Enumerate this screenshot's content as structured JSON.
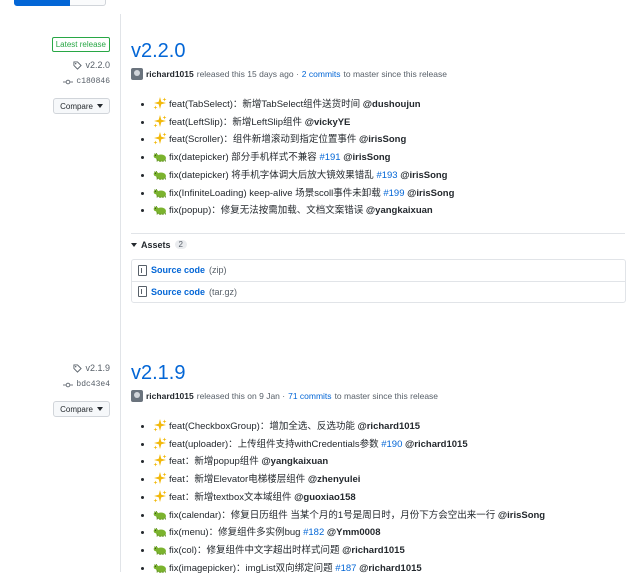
{
  "releases": [
    {
      "latest_label": "Latest release",
      "tag": "v2.2.0",
      "commit": "c180846",
      "compare_label": "Compare",
      "title": "v2.2.0",
      "author": "richard1015",
      "released_text": "released this 15 days ago ·",
      "commits_link": "2 commits",
      "since_text": "to master since this release",
      "notes": [
        {
          "emoji": "sparkles",
          "text": "feat(TabSelect)：新增TabSelect组件送货时间 ",
          "issue": "",
          "mention": "@dushoujun"
        },
        {
          "emoji": "sparkles",
          "text": "feat(LeftSlip)：新增LeftSlip组件 ",
          "issue": "",
          "mention": "@vickyYE"
        },
        {
          "emoji": "sparkles",
          "text": "feat(Scroller)：组件新增滚动到指定位置事件 ",
          "issue": "",
          "mention": "@irisSong"
        },
        {
          "emoji": "bug",
          "text": "fix(datepicker) 部分手机样式不兼容 ",
          "issue": "#191",
          "mention": "@irisSong"
        },
        {
          "emoji": "bug",
          "text": "fix(datepicker) 将手机字体调大后放大镜效果错乱 ",
          "issue": "#193",
          "mention": "@irisSong"
        },
        {
          "emoji": "bug",
          "text": "fix(InfiniteLoading) keep-alive 场景scoll事件未卸载 ",
          "issue": "#199",
          "mention": "@irisSong"
        },
        {
          "emoji": "bug",
          "text": "fix(popup)：修复无法按需加载、文档文案错误 ",
          "issue": "",
          "mention": "@yangkaixuan"
        }
      ],
      "assets_label": "Assets",
      "assets_count": "2",
      "assets": [
        {
          "name": "Source code",
          "ext": "(zip)"
        },
        {
          "name": "Source code",
          "ext": "(tar.gz)"
        }
      ]
    },
    {
      "tag": "v2.1.9",
      "commit": "bdc43e4",
      "compare_label": "Compare",
      "title": "v2.1.9",
      "author": "richard1015",
      "released_text": "released this on 9 Jan ·",
      "commits_link": "71 commits",
      "since_text": "to master since this release",
      "notes": [
        {
          "emoji": "sparkles",
          "text": "feat(CheckboxGroup)：增加全选、反选功能 ",
          "issue": "",
          "mention": "@richard1015"
        },
        {
          "emoji": "sparkles",
          "text": "feat(uploader)：上传组件支持withCredentials参数 ",
          "issue": "#190",
          "mention": "@richard1015"
        },
        {
          "emoji": "sparkles",
          "text": "feat：新增popup组件 ",
          "issue": "",
          "mention": "@yangkaixuan"
        },
        {
          "emoji": "sparkles",
          "text": "feat：新增Elevator电梯楼层组件 ",
          "issue": "",
          "mention": "@zhenyulei"
        },
        {
          "emoji": "sparkles",
          "text": "feat：新增textbox文本域组件 ",
          "issue": "",
          "mention": "@guoxiao158"
        },
        {
          "emoji": "bug",
          "text": "fix(calendar)：修复日历组件 当某个月的1号是周日时，月份下方会空出来一行 ",
          "issue": "",
          "mention": "@irisSong"
        },
        {
          "emoji": "bug",
          "text": "fix(menu)：修复组件多实例bug ",
          "issue": "#182",
          "mention": "@Ymm0008"
        },
        {
          "emoji": "bug",
          "text": "fix(col)：修复组件中文字超出时样式问题 ",
          "issue": "",
          "mention": "@richard1015"
        },
        {
          "emoji": "bug",
          "text": "fix(imagepicker)：imgList双向绑定问题 ",
          "issue": "#187",
          "mention": "@richard1015"
        }
      ]
    }
  ]
}
